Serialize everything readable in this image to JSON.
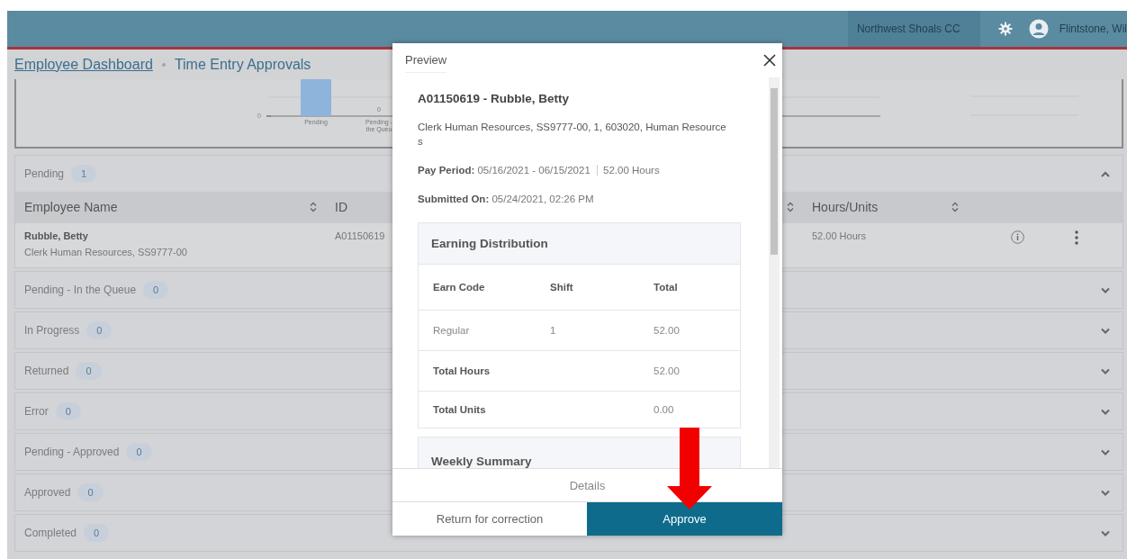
{
  "header": {
    "institution": "Northwest Shoals CC",
    "user": "Flintstone, Wil"
  },
  "breadcrumb": [
    {
      "label": "Employee Dashboard",
      "link": true
    },
    {
      "label": "Time Entry Approvals",
      "link": false
    }
  ],
  "chart": {
    "y_tick": "0",
    "bars": [
      {
        "label_lines": [
          "Pending"
        ],
        "kind": "bar"
      },
      {
        "label_lines": [
          "Pending -",
          "the Queu"
        ],
        "kind": "zero",
        "value_label": "0"
      }
    ]
  },
  "sections": [
    {
      "title": "Pending",
      "count": "1",
      "expanded": true,
      "table": {
        "columns": [
          {
            "label": "Employee Name",
            "sortable": true
          },
          {
            "label": "ID",
            "sortable": true
          },
          {
            "label": "Hours/Units",
            "sortable": true
          }
        ],
        "rows": [
          {
            "name": "Rubble, Betty",
            "position": "Clerk Human Resources, SS9777-00",
            "id": "A01150619",
            "hours": "52.00 Hours"
          }
        ]
      }
    },
    {
      "title": "Pending - In the Queue",
      "count": "0",
      "expanded": false
    },
    {
      "title": "In Progress",
      "count": "0",
      "expanded": false
    },
    {
      "title": "Returned",
      "count": "0",
      "expanded": false
    },
    {
      "title": "Error",
      "count": "0",
      "expanded": false
    },
    {
      "title": "Pending - Approved",
      "count": "0",
      "expanded": false
    },
    {
      "title": "Approved",
      "count": "0",
      "expanded": false
    },
    {
      "title": "Completed",
      "count": "0",
      "expanded": false
    }
  ],
  "preview": {
    "title": "Preview",
    "heading": "A01150619 - Rubble, Betty",
    "job": "Clerk Human Resources, SS9777-00, 1, 603020, Human Resources",
    "pay_period": {
      "label": "Pay Period:",
      "value": "05/16/2021 - 06/15/2021",
      "hours": "52.00 Hours"
    },
    "submitted": {
      "label": "Submitted On:",
      "value": "05/24/2021, 02:26 PM"
    },
    "earning": {
      "title": "Earning Distribution",
      "columns": [
        "Earn Code",
        "Shift",
        "Total"
      ],
      "rows": [
        {
          "cells": [
            "Regular",
            "1",
            "52.00"
          ],
          "kind": "detail"
        },
        {
          "cells": [
            "Total Hours",
            "",
            "52.00"
          ],
          "kind": "total"
        },
        {
          "cells": [
            "Total Units",
            "",
            "0.00"
          ],
          "kind": "total"
        }
      ]
    },
    "weekly": {
      "title": "Weekly Summary"
    },
    "buttons": [
      {
        "label": "Details",
        "kind": "plain"
      },
      {
        "label": "Return for correction",
        "kind": "secondary"
      },
      {
        "label": "Approve",
        "kind": "primary"
      }
    ]
  }
}
